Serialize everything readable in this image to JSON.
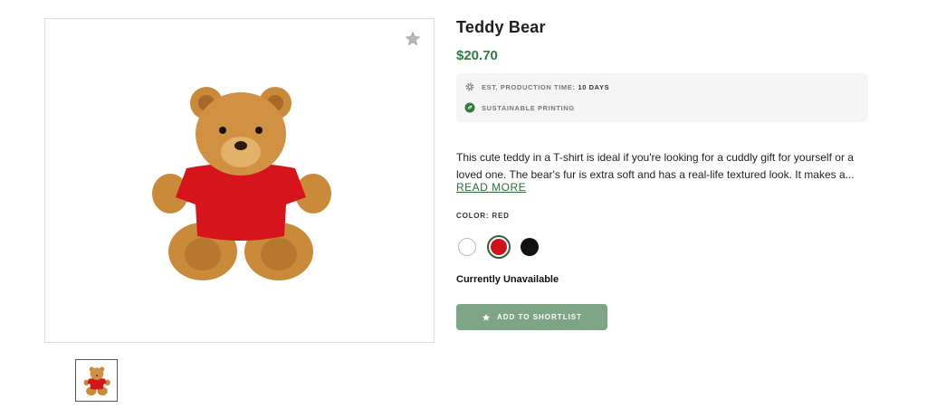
{
  "product": {
    "title": "Teddy Bear",
    "price": "$20.70",
    "features": [
      {
        "icon": "gear-icon",
        "label": "EST. PRODUCTION TIME:",
        "value": "10 DAYS"
      },
      {
        "icon": "leaf-icon",
        "label": "SUSTAINABLE PRINTING"
      }
    ],
    "description": "This cute teddy in a T-shirt is ideal if you're looking for a cuddly gift for yourself or a loved one. The bear's fur is extra soft and has a real-life textured look. It makes a...",
    "read_more": "READ MORE",
    "color_label": "COLOR: RED",
    "colors": [
      "#ffffff",
      "#d0101a",
      "#111111"
    ],
    "selected_color": "RED",
    "availability": "Currently Unavailable",
    "cta": "ADD TO SHORTLIST"
  },
  "colors": {
    "accent": "#2e7d3e",
    "button": "#7ea585"
  }
}
